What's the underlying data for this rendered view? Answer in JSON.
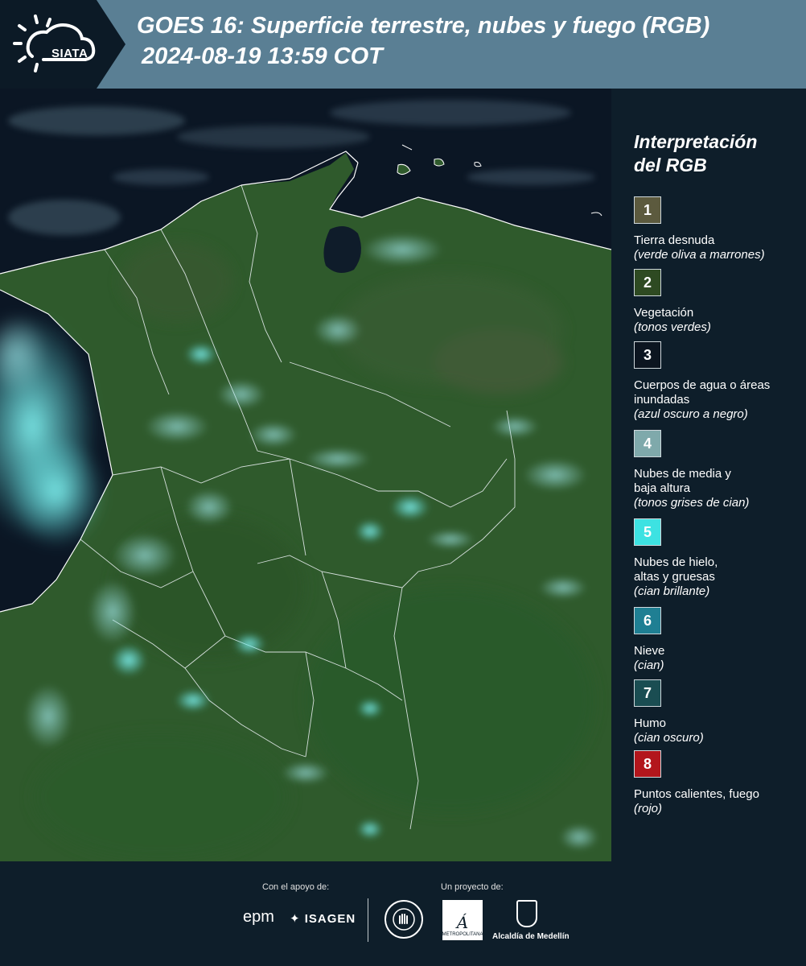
{
  "header": {
    "logo_text": "SIATA",
    "title": "GOES 16: Superficie terrestre, nubes y fuego (RGB)",
    "subtitle": "2024-08-19 13:59 COT"
  },
  "legend": {
    "title_line1": "Interpretación",
    "title_line2": "del RGB",
    "items": [
      {
        "number": "1",
        "color": "#5c5a3e",
        "label": "Tierra desnuda",
        "note": "(verde oliva a marrones)"
      },
      {
        "number": "2",
        "color": "#2e4a22",
        "label": "Vegetación",
        "note": "(tonos verdes)"
      },
      {
        "number": "3",
        "color": "#0c1520",
        "label": "Cuerpos de agua o áreas inundadas",
        "note": "(azul oscuro a negro)"
      },
      {
        "number": "4",
        "color": "#7fa9ab",
        "label": "Nubes de media y baja altura",
        "note": "(tonos grises de cian)"
      },
      {
        "number": "5",
        "color": "#3de2e2",
        "label": "Nubes de hielo, altas y gruesas",
        "note": "(cian brillante)"
      },
      {
        "number": "6",
        "color": "#1f7f93",
        "label": "Nieve",
        "note": "(cian)"
      },
      {
        "number": "7",
        "color": "#1a4d52",
        "label": "Humo",
        "note": "(cian oscuro)"
      },
      {
        "number": "8",
        "color": "#b3161c",
        "label": "Puntos calientes, fuego",
        "note": "(rojo)"
      }
    ]
  },
  "footer": {
    "support_label": "Con el apoyo de:",
    "project_label": "Un proyecto de:",
    "epm": "epm",
    "isagen": "ISAGEN",
    "area_text": "METROPOLITANA",
    "alcaldia": "Alcaldía de Medellín"
  },
  "colors": {
    "header_band": "#5a7f94",
    "background": "#0e1e2a",
    "vegetation": "#2f5a2c",
    "ocean": "#0b1624",
    "cloud_cyan": "#5fe0e0"
  }
}
